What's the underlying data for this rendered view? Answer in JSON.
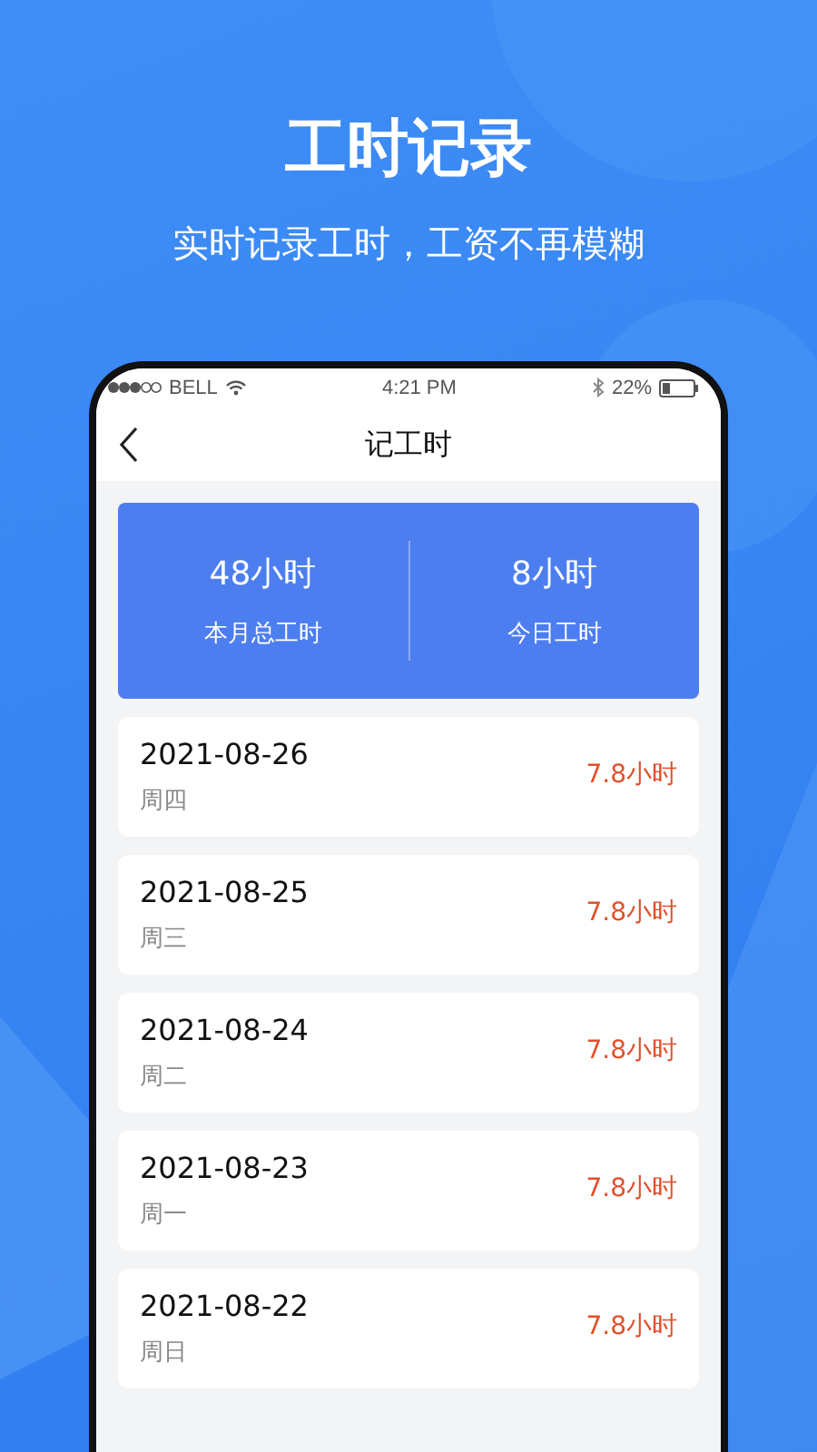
{
  "headline": "工时记录",
  "tagline": "实时记录工时，工资不再模糊",
  "status_bar": {
    "carrier": "BELL",
    "time": "4:21 PM",
    "battery": "22%"
  },
  "nav": {
    "title": "记工时"
  },
  "summary": [
    {
      "value": "48小时",
      "label": "本月总工时"
    },
    {
      "value": "8小时",
      "label": "今日工时"
    }
  ],
  "records": [
    {
      "date": "2021-08-26",
      "weekday": "周四",
      "hours": "7.8小时"
    },
    {
      "date": "2021-08-25",
      "weekday": "周三",
      "hours": "7.8小时"
    },
    {
      "date": "2021-08-24",
      "weekday": "周二",
      "hours": "7.8小时"
    },
    {
      "date": "2021-08-23",
      "weekday": "周一",
      "hours": "7.8小时"
    },
    {
      "date": "2021-08-22",
      "weekday": "周日",
      "hours": "7.8小时"
    }
  ]
}
